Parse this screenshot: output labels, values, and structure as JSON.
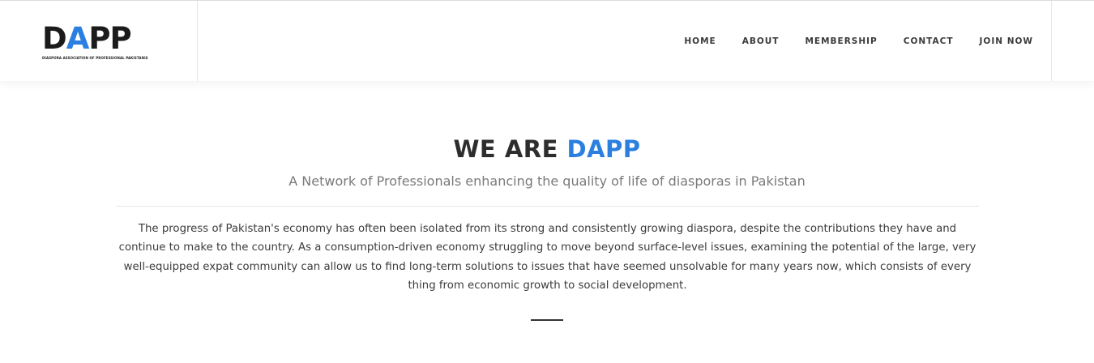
{
  "logo": {
    "letters": "DAPP",
    "tagline": "DIASPORA ASSOCIATION OF PROFESSIONAL PAKISTANIS"
  },
  "nav": {
    "items": [
      "HOME",
      "ABOUT",
      "MEMBERSHIP",
      "CONTACT",
      "JOIN NOW"
    ]
  },
  "hero": {
    "title_prefix": "WE ARE",
    "title_accent": "DAPP",
    "subtitle": "A Network of Professionals enhancing the quality of life of diasporas in Pakistan",
    "body": "The progress of Pakistan's economy has often been isolated from its strong and consistently growing diaspora, despite the contributions they have and continue to make to the country. As a consumption-driven economy struggling to move beyond surface-level issues, examining the potential of the large, very well-equipped expat community can allow us to find long-term solutions to issues that have seemed unsolvable for many years now, which consists of every thing from economic growth to social development."
  },
  "colors": {
    "accent": "#2b7fe0",
    "text_dark": "#2d2d2d",
    "text_muted": "#7a7a7a"
  }
}
